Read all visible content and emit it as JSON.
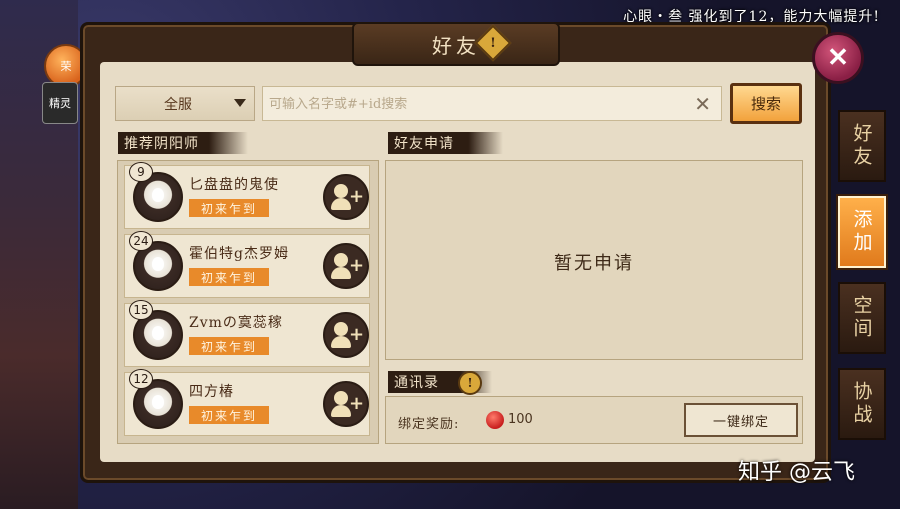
{
  "top_message": "心眼・叁 强化到了12，能力大幅提升!",
  "title": "好友",
  "title_warn": "!",
  "close": "✕",
  "side_badge": "荣",
  "side_spirit": "精灵",
  "scope": "全服",
  "search": {
    "placeholder": "可输入名字或#+id搜索",
    "button": "搜索"
  },
  "recommend": {
    "label": "推荐阴阳师",
    "items": [
      {
        "level": "9",
        "name": "匕盘盘的鬼使",
        "tag": "初来乍到"
      },
      {
        "level": "24",
        "name": "霍伯特g杰罗姆",
        "tag": "初来乍到"
      },
      {
        "level": "15",
        "name": "Zvmの寞蕊稼",
        "tag": "初来乍到"
      },
      {
        "level": "12",
        "name": "四方椿",
        "tag": "初来乍到"
      }
    ]
  },
  "requests": {
    "label": "好友申请",
    "empty": "暂无申请"
  },
  "addressbook": {
    "label": "通讯录",
    "warn": "!",
    "reward_label": "绑定奖励:",
    "reward_value": "100",
    "bind_button": "一键绑定"
  },
  "tabs": [
    {
      "label": "好友",
      "active": false
    },
    {
      "label": "添加",
      "active": true
    },
    {
      "label": "空间",
      "active": false
    },
    {
      "label": "协战",
      "active": false
    }
  ],
  "watermark": "知乎 @云飞",
  "colors": {
    "accent": "#f2a23c",
    "tag": "#e88a2a",
    "panel": "#e7dcc6",
    "frame": "#3a2618"
  }
}
